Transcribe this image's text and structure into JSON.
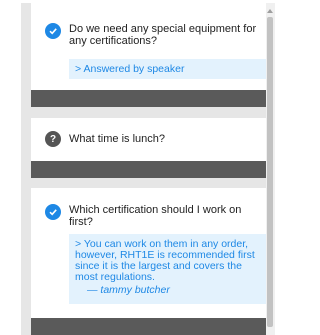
{
  "questions": [
    {
      "status": "answered",
      "text": "Do we need any special equipment for any certifications?",
      "answer": "> Answered by speaker"
    },
    {
      "status": "open",
      "badge": "?",
      "text": "What time is lunch?"
    },
    {
      "status": "answered",
      "text": "Which certification should I work on first?",
      "answer": "> You can work on them in any order, however, RHT1E is recommended first since it is the largest and covers the most regulations.",
      "author": "— tammy butcher"
    }
  ],
  "colors": {
    "accent": "#1e88e5",
    "answer_bg": "#e3f2fd",
    "footer": "#5a5a5a"
  }
}
